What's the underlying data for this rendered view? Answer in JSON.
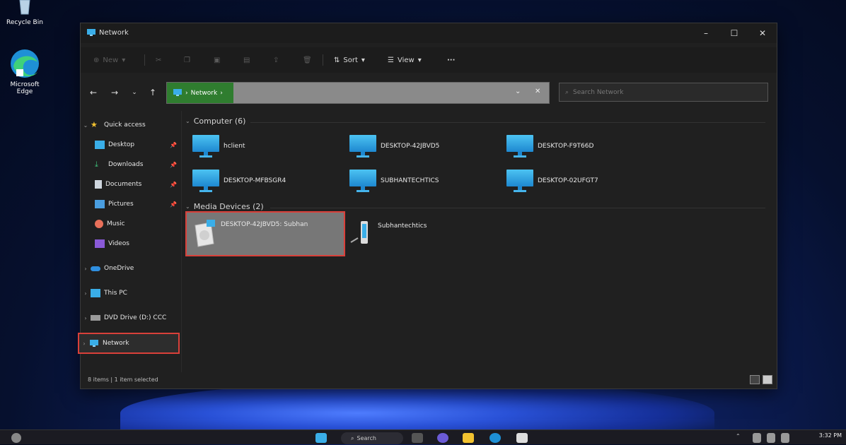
{
  "desktop": {
    "icons": [
      {
        "label": "Recycle Bin",
        "icon": "recycle-bin-icon"
      },
      {
        "label": "Microsoft Edge",
        "icon": "edge-icon"
      }
    ]
  },
  "window": {
    "title": "Network",
    "controls": {
      "minimize": "–",
      "maximize": "☐",
      "close": "✕"
    },
    "toolbar": {
      "new_label": "New",
      "sort_label": "Sort",
      "view_label": "View",
      "more_label": "···"
    },
    "address": {
      "crumb": "Network",
      "search_placeholder": "Search Network"
    },
    "sidebar": {
      "quick_access": "Quick access",
      "items": [
        {
          "label": "Desktop",
          "icon": "desktop-icon",
          "pinned": true
        },
        {
          "label": "Downloads",
          "icon": "downloads-icon",
          "pinned": true
        },
        {
          "label": "Documents",
          "icon": "documents-icon",
          "pinned": true
        },
        {
          "label": "Pictures",
          "icon": "pictures-icon",
          "pinned": true
        },
        {
          "label": "Music",
          "icon": "music-icon",
          "pinned": false
        },
        {
          "label": "Videos",
          "icon": "videos-icon",
          "pinned": false
        }
      ],
      "onedrive": "OneDrive",
      "this_pc": "This PC",
      "dvd": "DVD Drive (D:) CCC",
      "network": "Network"
    },
    "content": {
      "computer_group": "Computer (6)",
      "computers": [
        "hclient",
        "DESKTOP-42JBVD5",
        "DESKTOP-F9T66D",
        "DESKTOP-MFBSGR4",
        "SUBHANTECHTICS",
        "DESKTOP-02UFGT7"
      ],
      "media_group": "Media Devices (2)",
      "media": [
        "DESKTOP-42JBVD5: Subhan",
        "Subhantechtics"
      ]
    },
    "status": {
      "items": "8 items",
      "selected": "1 item selected"
    }
  },
  "taskbar": {
    "search_label": "Search",
    "time": "3:32 PM"
  },
  "colors": {
    "selection_outline": "#d9403a",
    "address_crumb": "#2f7d2f",
    "monitor_blue": "#3aaee8"
  }
}
